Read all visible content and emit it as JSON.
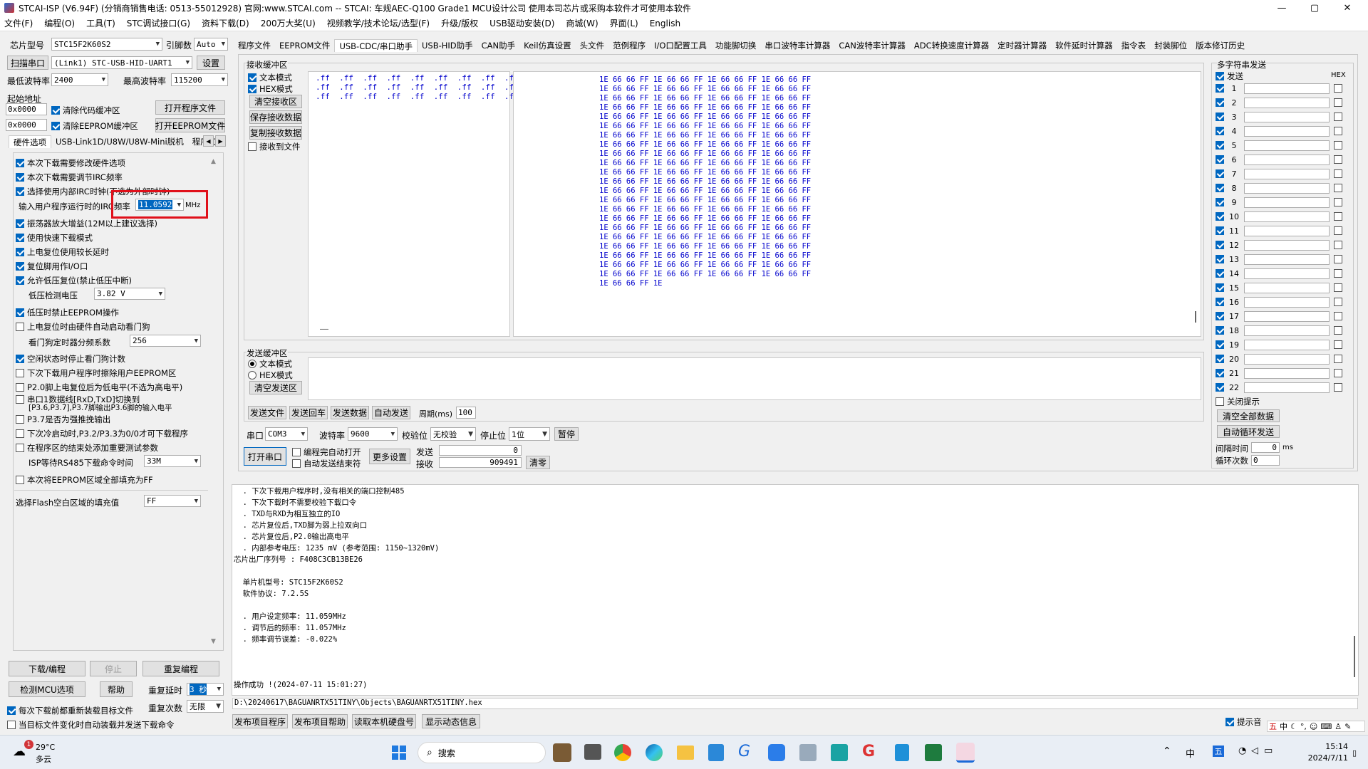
{
  "window": {
    "title": "STCAI-ISP (V6.94F) (分销商销售电话: 0513-55012928) 官网:www.STCAI.com  -- STCAI: 车规AEC-Q100 Grade1 MCU设计公司 使用本司芯片或采购本软件才可使用本软件",
    "min": "—",
    "max": "▢",
    "close": "✕"
  },
  "menu": [
    "文件(F)",
    "编程(O)",
    "工具(T)",
    "STC调试接口(G)",
    "资料下载(D)",
    "200万大奖(U)",
    "视频教学/技术论坛/选型(F)",
    "升级/版权",
    "USB驱动安装(D)",
    "商城(W)",
    "界面(L)",
    "English"
  ],
  "left": {
    "chip_label": "芯片型号",
    "chip_value": "STC15F2K60S2",
    "pin_label": "引脚数",
    "pin_value": "Auto",
    "scan_btn": "扫描串口",
    "port_value": "(Link1) STC-USB-HID-UART1",
    "settings_btn": "设置",
    "min_baud_label": "最低波特率",
    "min_baud": "2400",
    "max_baud_label": "最高波特率",
    "max_baud": "115200",
    "start_addr_label": "起始地址",
    "addr1": "0x0000",
    "clear_code": "清除代码缓冲区",
    "open_prog": "打开程序文件",
    "addr2": "0x0000",
    "clear_eeprom": "清除EEPROM缓冲区",
    "open_eeprom": "打开EEPROM文件",
    "hw_tabs": [
      "硬件选项",
      "USB-Link1D/U8W/U8W-Mini脱机",
      "程序加"
    ],
    "options": [
      {
        "label": "本次下载需要修改硬件选项",
        "checked": true
      },
      {
        "label": "本次下载需要调节IRC频率",
        "checked": true
      },
      {
        "label": "选择使用内部IRC时钟(不选为外部时钟)",
        "checked": true
      }
    ],
    "freq_label": "输入用户程序运行时的IRC频率",
    "freq_value": "11.0592",
    "freq_unit": "MHz",
    "options2": [
      {
        "label": "振荡器放大增益(12M以上建议选择)",
        "checked": true
      },
      {
        "label": "使用快速下载模式",
        "checked": true
      },
      {
        "label": "上电复位使用较长延时",
        "checked": true
      },
      {
        "label": "复位脚用作I/O口",
        "checked": true
      },
      {
        "label": "允许低压复位(禁止低压中断)",
        "checked": true
      }
    ],
    "lv_label": "低压检测电压",
    "lv_value": "3.82 V",
    "options3": [
      {
        "label": "低压时禁止EEPROM操作",
        "checked": true
      },
      {
        "label": "上电复位时由硬件自动启动看门狗",
        "checked": false
      }
    ],
    "wdt_label": "看门狗定时器分频系数",
    "wdt_value": "256",
    "options4": [
      {
        "label": "空闲状态时停止看门狗计数",
        "checked": true
      },
      {
        "label": "下次下载用户程序时擦除用户EEPROM区",
        "checked": false
      },
      {
        "label": "P2.0脚上电复位后为低电平(不选为高电平)",
        "checked": false
      },
      {
        "label": "串口1数据线[RxD,TxD]切换到",
        "checked": false
      },
      {
        "label": "P3.7是否为强推挽输出",
        "checked": false
      },
      {
        "label": "下次冷启动时,P3.2/P3.3为0/0才可下载程序",
        "checked": false
      },
      {
        "label": "在程序区的结束处添加重要测试参数",
        "checked": false
      }
    ],
    "uart_sub": "[P3.6,P3.7],P3.7脚输出P3.6脚的输入电平",
    "isp_label": "ISP等待RS485下载命令时间",
    "isp_value": "33M",
    "eeprom_fill": "本次将EEPROM区域全部填充为FF",
    "flash_fill_label": "选择Flash空白区域的填充值",
    "flash_fill_value": "FF",
    "download_btn": "下载/编程",
    "stop_btn": "停止",
    "reprog_btn": "重复编程",
    "check_btn": "检测MCU选项",
    "help_btn": "帮助",
    "repeat_delay_label": "重复延时",
    "repeat_delay": "3 秒",
    "repeat_count_label": "重复次数",
    "repeat_count": "无限",
    "reload_label": "每次下载前都重新装载目标文件",
    "auto_label": "当目标文件变化时自动装载并发送下载命令"
  },
  "toptabs": [
    "程序文件",
    "EEPROM文件",
    "USB-CDC/串口助手",
    "USB-HID助手",
    "CAN助手",
    "Keil仿真设置",
    "头文件",
    "范例程序",
    "I/O口配置工具",
    "功能脚切换",
    "串口波特率计算器",
    "CAN波特率计算器",
    "ADC转换速度计算器",
    "定时器计算器",
    "软件延时计算器",
    "指令表",
    "封装脚位",
    "版本修订历史"
  ],
  "recv": {
    "title": "接收缓冲区",
    "text_mode": "文本模式",
    "hex_mode": "HEX模式",
    "clear": "清空接收区",
    "save": "保存接收数据",
    "copy": "复制接收数据",
    "to_file": "接收到文件",
    "left_lines": [
      ".ff  .ff  .ff  .ff  .ff  .ff  .ff  .ff  .ff",
      ".ff  .ff  .ff  .ff  .ff  .ff  .ff  .ff  .ff",
      ".ff  .ff  .ff  .ff  .ff  .ff  .ff  .ff  .ff"
    ],
    "hex_line": "1E 66 66 FF 1E 66 66 FF 1E 66 66 FF 1E 66 66 FF",
    "hex_last": "1E 66 66 FF 1E",
    "dash": "——"
  },
  "send": {
    "title": "发送缓冲区",
    "text_mode": "文本模式",
    "hex_mode": "HEX模式",
    "clear": "清空发送区",
    "send_file": "发送文件",
    "send_return": "发送回车",
    "send_data": "发送数据",
    "auto_send": "自动发送",
    "period_label": "周期(ms)",
    "period": "100",
    "port_label": "串口",
    "port": "COM3",
    "baud_label": "波特率",
    "baud": "9600",
    "parity_label": "校验位",
    "parity": "无校验",
    "stop_label": "停止位",
    "stop": "1位",
    "pause": "暂停",
    "open_port": "打开串口",
    "auto_open": "编程完自动打开",
    "auto_end": "自动发送结束符",
    "more": "更多设置",
    "tx_label": "发送",
    "tx_count": "0",
    "rx_label": "接收",
    "rx_count": "909491",
    "clear_count": "清零"
  },
  "multi": {
    "title": "多字符串发送",
    "send_label": "发送",
    "hex_label": "HEX",
    "rows": [
      "1",
      "2",
      "3",
      "4",
      "5",
      "6",
      "7",
      "8",
      "9",
      "10",
      "11",
      "12",
      "13",
      "14",
      "15",
      "16",
      "17",
      "18",
      "19",
      "20",
      "21",
      "22"
    ],
    "close_tip": "关闭提示",
    "clear_all": "清空全部数据",
    "auto_loop": "自动循环发送",
    "interval_label": "间隔时间",
    "interval": "0",
    "interval_unit": "ms",
    "loop_label": "循环次数",
    "loop": "0"
  },
  "log": {
    "lines": [
      "  . 下次下载用户程序时,没有相关的端口控制485",
      "  . 下次下载时不需要校验下载口令",
      "  . TXD与RXD为相互独立的IO",
      "  . 芯片复位后,TXD脚为弱上拉双向口",
      "  . 芯片复位后,P2.0输出高电平",
      "  . 内部参考电压: 1235 mV (参考范围: 1150~1320mV)",
      "芯片出厂序列号 : F408C3CB13BE26",
      "",
      "  单片机型号: STC15F2K60S2",
      "  软件协议: 7.2.5S",
      "",
      "  . 用户设定频率: 11.059MHz",
      "  . 调节后的频率: 11.057MHz",
      "  . 频率调节误差: -0.022%",
      "",
      "",
      "",
      "操作成功 !(2024-07-11 15:01:27)"
    ],
    "path": "D:\\20240617\\BAGUANRTX51TINY\\Objects\\BAGUANRTX51TINY.hex"
  },
  "bottom": {
    "publish": "发布项目程序",
    "publish_help": "发布项目帮助",
    "read_disk": "读取本机硬盘号",
    "show_info": "显示动态信息",
    "tip_sound": "提示音"
  },
  "taskbar": {
    "weather_temp": "29°C",
    "weather_desc": "多云",
    "badge": "1",
    "search": "搜索",
    "ime1": "中",
    "ime2": "五",
    "time": "15:14",
    "date": "2024/7/11"
  },
  "colors": {
    "accent": "#0067c0",
    "highlight_red": "#e0101a",
    "hex_blue": "#0000cc"
  }
}
